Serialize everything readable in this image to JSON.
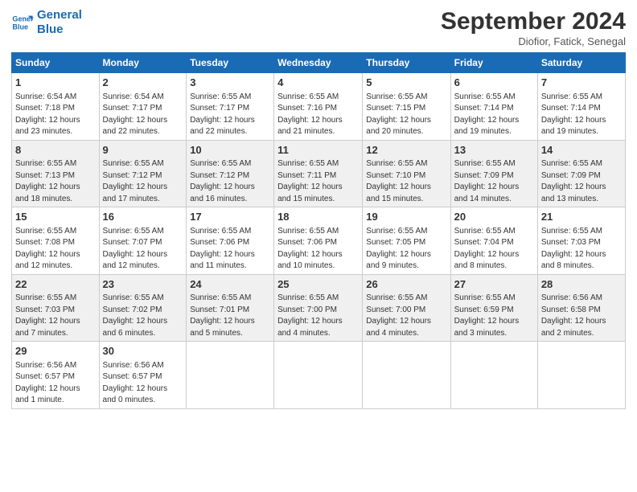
{
  "header": {
    "logo_line1": "General",
    "logo_line2": "Blue",
    "month_title": "September 2024",
    "location": "Diofior, Fatick, Senegal"
  },
  "days_of_week": [
    "Sunday",
    "Monday",
    "Tuesday",
    "Wednesday",
    "Thursday",
    "Friday",
    "Saturday"
  ],
  "weeks": [
    [
      {
        "day": "1",
        "info": "Sunrise: 6:54 AM\nSunset: 7:18 PM\nDaylight: 12 hours\nand 23 minutes."
      },
      {
        "day": "2",
        "info": "Sunrise: 6:54 AM\nSunset: 7:17 PM\nDaylight: 12 hours\nand 22 minutes."
      },
      {
        "day": "3",
        "info": "Sunrise: 6:55 AM\nSunset: 7:17 PM\nDaylight: 12 hours\nand 22 minutes."
      },
      {
        "day": "4",
        "info": "Sunrise: 6:55 AM\nSunset: 7:16 PM\nDaylight: 12 hours\nand 21 minutes."
      },
      {
        "day": "5",
        "info": "Sunrise: 6:55 AM\nSunset: 7:15 PM\nDaylight: 12 hours\nand 20 minutes."
      },
      {
        "day": "6",
        "info": "Sunrise: 6:55 AM\nSunset: 7:14 PM\nDaylight: 12 hours\nand 19 minutes."
      },
      {
        "day": "7",
        "info": "Sunrise: 6:55 AM\nSunset: 7:14 PM\nDaylight: 12 hours\nand 19 minutes."
      }
    ],
    [
      {
        "day": "8",
        "info": "Sunrise: 6:55 AM\nSunset: 7:13 PM\nDaylight: 12 hours\nand 18 minutes."
      },
      {
        "day": "9",
        "info": "Sunrise: 6:55 AM\nSunset: 7:12 PM\nDaylight: 12 hours\nand 17 minutes."
      },
      {
        "day": "10",
        "info": "Sunrise: 6:55 AM\nSunset: 7:12 PM\nDaylight: 12 hours\nand 16 minutes."
      },
      {
        "day": "11",
        "info": "Sunrise: 6:55 AM\nSunset: 7:11 PM\nDaylight: 12 hours\nand 15 minutes."
      },
      {
        "day": "12",
        "info": "Sunrise: 6:55 AM\nSunset: 7:10 PM\nDaylight: 12 hours\nand 15 minutes."
      },
      {
        "day": "13",
        "info": "Sunrise: 6:55 AM\nSunset: 7:09 PM\nDaylight: 12 hours\nand 14 minutes."
      },
      {
        "day": "14",
        "info": "Sunrise: 6:55 AM\nSunset: 7:09 PM\nDaylight: 12 hours\nand 13 minutes."
      }
    ],
    [
      {
        "day": "15",
        "info": "Sunrise: 6:55 AM\nSunset: 7:08 PM\nDaylight: 12 hours\nand 12 minutes."
      },
      {
        "day": "16",
        "info": "Sunrise: 6:55 AM\nSunset: 7:07 PM\nDaylight: 12 hours\nand 12 minutes."
      },
      {
        "day": "17",
        "info": "Sunrise: 6:55 AM\nSunset: 7:06 PM\nDaylight: 12 hours\nand 11 minutes."
      },
      {
        "day": "18",
        "info": "Sunrise: 6:55 AM\nSunset: 7:06 PM\nDaylight: 12 hours\nand 10 minutes."
      },
      {
        "day": "19",
        "info": "Sunrise: 6:55 AM\nSunset: 7:05 PM\nDaylight: 12 hours\nand 9 minutes."
      },
      {
        "day": "20",
        "info": "Sunrise: 6:55 AM\nSunset: 7:04 PM\nDaylight: 12 hours\nand 8 minutes."
      },
      {
        "day": "21",
        "info": "Sunrise: 6:55 AM\nSunset: 7:03 PM\nDaylight: 12 hours\nand 8 minutes."
      }
    ],
    [
      {
        "day": "22",
        "info": "Sunrise: 6:55 AM\nSunset: 7:03 PM\nDaylight: 12 hours\nand 7 minutes."
      },
      {
        "day": "23",
        "info": "Sunrise: 6:55 AM\nSunset: 7:02 PM\nDaylight: 12 hours\nand 6 minutes."
      },
      {
        "day": "24",
        "info": "Sunrise: 6:55 AM\nSunset: 7:01 PM\nDaylight: 12 hours\nand 5 minutes."
      },
      {
        "day": "25",
        "info": "Sunrise: 6:55 AM\nSunset: 7:00 PM\nDaylight: 12 hours\nand 4 minutes."
      },
      {
        "day": "26",
        "info": "Sunrise: 6:55 AM\nSunset: 7:00 PM\nDaylight: 12 hours\nand 4 minutes."
      },
      {
        "day": "27",
        "info": "Sunrise: 6:55 AM\nSunset: 6:59 PM\nDaylight: 12 hours\nand 3 minutes."
      },
      {
        "day": "28",
        "info": "Sunrise: 6:56 AM\nSunset: 6:58 PM\nDaylight: 12 hours\nand 2 minutes."
      }
    ],
    [
      {
        "day": "29",
        "info": "Sunrise: 6:56 AM\nSunset: 6:57 PM\nDaylight: 12 hours\nand 1 minute."
      },
      {
        "day": "30",
        "info": "Sunrise: 6:56 AM\nSunset: 6:57 PM\nDaylight: 12 hours\nand 0 minutes."
      },
      {
        "day": "",
        "info": ""
      },
      {
        "day": "",
        "info": ""
      },
      {
        "day": "",
        "info": ""
      },
      {
        "day": "",
        "info": ""
      },
      {
        "day": "",
        "info": ""
      }
    ]
  ]
}
